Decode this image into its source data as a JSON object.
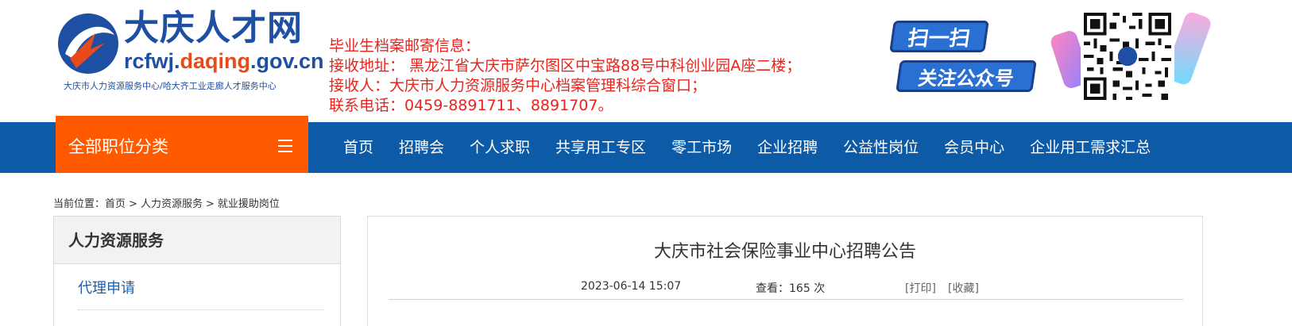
{
  "colors": {
    "nav_bg": "#0d5aa7",
    "category_bg": "#ff5a00",
    "notice_text": "#e8241c",
    "logo_blue": "#1f4fa3",
    "link_blue": "#1f5fa8"
  },
  "logo": {
    "title": "大庆人才网",
    "domain_prefix": "rcfwj.",
    "domain_accent": "daqing",
    "domain_suffix": ".gov.cn",
    "subtitle": "大庆市人力资源服务中心/哈大齐工业走廊人才服务中心"
  },
  "notice": {
    "line1": "毕业生档案邮寄信息：",
    "line2": "接收地址： 黑龙江省大庆市萨尔图区中宝路88号中科创业园A座二楼；",
    "line3": "接收人：大庆市人力资源服务中心档案管理科综合窗口；",
    "line4": "联系电话：0459-8891711、8891707。"
  },
  "wechat": {
    "scan_label": "扫一扫",
    "follow_label": "关注公众号",
    "qr_icon": "qr-code-icon"
  },
  "nav": {
    "category_label": "全部职位分类",
    "menu_icon": "menu-icon",
    "items": [
      {
        "label": "首页"
      },
      {
        "label": "招聘会"
      },
      {
        "label": "个人求职"
      },
      {
        "label": "共享用工专区"
      },
      {
        "label": "零工市场"
      },
      {
        "label": "企业招聘"
      },
      {
        "label": "公益性岗位"
      },
      {
        "label": "会员中心"
      },
      {
        "label": "企业用工需求汇总"
      }
    ]
  },
  "breadcrumb": {
    "prefix": "当前位置：",
    "items": [
      "首页",
      "人力资源服务",
      "就业援助岗位"
    ],
    "separator": ">"
  },
  "sidebar": {
    "title": "人力资源服务",
    "items": [
      {
        "label": "代理申请"
      }
    ]
  },
  "article": {
    "title": "大庆市社会保险事业中心招聘公告",
    "date": "2023-06-14 15:07",
    "views_label": "查看：",
    "views": "165",
    "views_unit": "次",
    "print_label": "[打印]",
    "favorite_label": "[收藏]"
  }
}
